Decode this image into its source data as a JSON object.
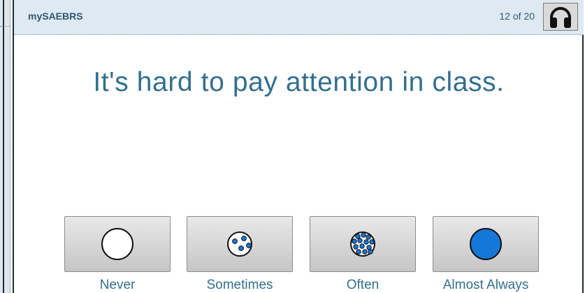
{
  "header": {
    "app_title": "mySAEBRS",
    "progress": "12 of 20",
    "audio_icon": "headphones-icon"
  },
  "question": {
    "text": "It's hard to pay attention in class."
  },
  "answers": [
    {
      "label": "Never",
      "icon": "empty-circle-icon"
    },
    {
      "label": "Sometimes",
      "icon": "few-dots-circle-icon"
    },
    {
      "label": "Often",
      "icon": "many-dots-circle-icon"
    },
    {
      "label": "Almost Always",
      "icon": "filled-circle-icon"
    }
  ],
  "colors": {
    "accent_blue": "#1578d9",
    "text_blue": "#336f8f",
    "header_bg": "#dfe9f1"
  }
}
